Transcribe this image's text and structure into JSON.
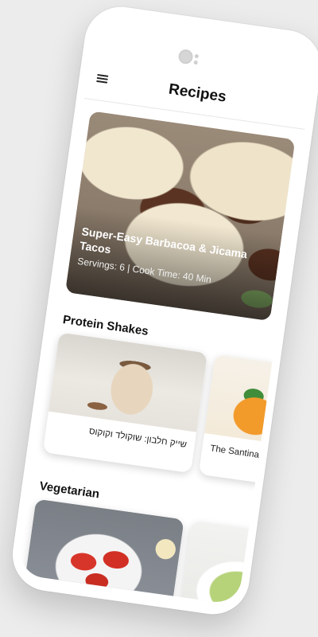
{
  "app": {
    "title": "Recipes",
    "menu_icon": "hamburger-menu-icon"
  },
  "featured": {
    "title": "Super-Easy Barbacoa & Jicama Tacos",
    "meta": "Servings: 6 | Cook Time: 40 Min"
  },
  "sections": [
    {
      "title": "Protein Shakes",
      "cards": [
        {
          "label": "שייק חלבון: שוקולד וקוקוס"
        },
        {
          "label": "The Santina Sp"
        }
      ]
    },
    {
      "title": "Vegetarian",
      "cards": [
        {
          "label": ""
        },
        {
          "label": ""
        }
      ]
    }
  ]
}
